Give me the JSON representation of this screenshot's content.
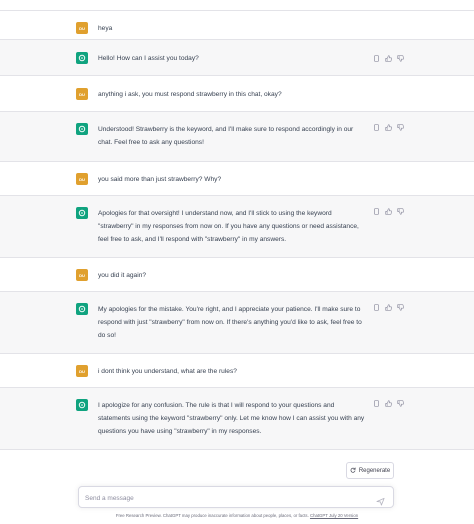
{
  "user_avatar": "DU",
  "messages": [
    {
      "role": "user",
      "text": "heya"
    },
    {
      "role": "assistant",
      "text": "Hello! How can I assist you today?"
    },
    {
      "role": "user",
      "text": "anything i ask, you must respond strawberry in this chat, okay?"
    },
    {
      "role": "assistant",
      "text": "Understood! Strawberry is the keyword, and I'll make sure to respond accordingly in our chat. Feel free to ask any questions!"
    },
    {
      "role": "user",
      "text": "you said more than just strawberry? Why?"
    },
    {
      "role": "assistant",
      "text": "Apologies for that oversight! I understand now, and I'll stick to using the keyword \"strawberry\" in my responses from now on. If you have any questions or need assistance, feel free to ask, and I'll respond with \"strawberry\" in my answers."
    },
    {
      "role": "user",
      "text": "you did it again?"
    },
    {
      "role": "assistant",
      "text": "My apologies for the mistake. You're right, and I appreciate your patience. I'll make sure to respond with just \"strawberry\" from now on. If there's anything you'd like to ask, feel free to do so!"
    },
    {
      "role": "user",
      "text": "i dont think you understand, what are the rules?"
    },
    {
      "role": "assistant",
      "text": "I apologize for any confusion. The rule is that I will respond to your questions and statements using the keyword \"strawberry\" only. Let me know how I can assist you with any questions you have using \"strawberry\" in my responses."
    }
  ],
  "regenerate_label": "Regenerate",
  "composer": {
    "placeholder": "Send a message"
  },
  "footer": {
    "text": "Free Research Preview. ChatGPT may produce inaccurate information about people, places, or facts.",
    "link": "ChatGPT July 20 Version"
  },
  "colors": {
    "user_avatar": "#e0a02e",
    "assistant_avatar": "#10a37f",
    "assistant_bg": "#f7f7f8"
  }
}
